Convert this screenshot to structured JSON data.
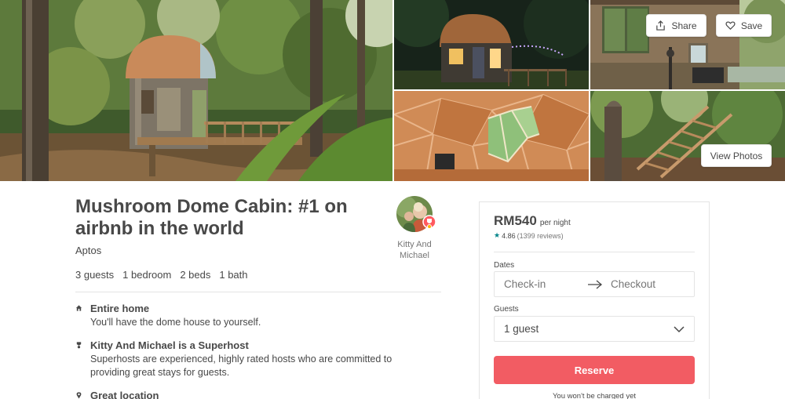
{
  "gallery": {
    "share_label": "Share",
    "save_label": "Save",
    "view_photos_label": "View Photos"
  },
  "listing": {
    "title": "Mushroom Dome Cabin: #1 on airbnb in the world",
    "location": "Aptos",
    "stats": [
      "3 guests",
      "1 bedroom",
      "2 beds",
      "1 bath"
    ],
    "host_name": "Kitty And Michael",
    "features": [
      {
        "icon": "home-icon",
        "title": "Entire home",
        "desc": "You'll have the dome house to yourself."
      },
      {
        "icon": "superhost-badge-icon",
        "title": "Kitty And Michael is a Superhost",
        "desc": "Superhosts are experienced, highly rated hosts who are committed to providing great stays for guests."
      },
      {
        "icon": "location-pin-icon",
        "title": "Great location",
        "desc": ""
      }
    ]
  },
  "booking": {
    "price": "RM540",
    "per_night": "per night",
    "rating": "4.86",
    "reviews": "(1399 reviews)",
    "dates_label": "Dates",
    "checkin_placeholder": "Check-in",
    "checkout_placeholder": "Checkout",
    "guests_label": "Guests",
    "guests_value": "1 guest",
    "reserve_label": "Reserve",
    "note": "You won't be charged yet"
  },
  "colors": {
    "accent": "#F25C63",
    "rating_star": "#008489",
    "text": "#484848",
    "muted": "#767676",
    "border": "#E4E4E4"
  }
}
